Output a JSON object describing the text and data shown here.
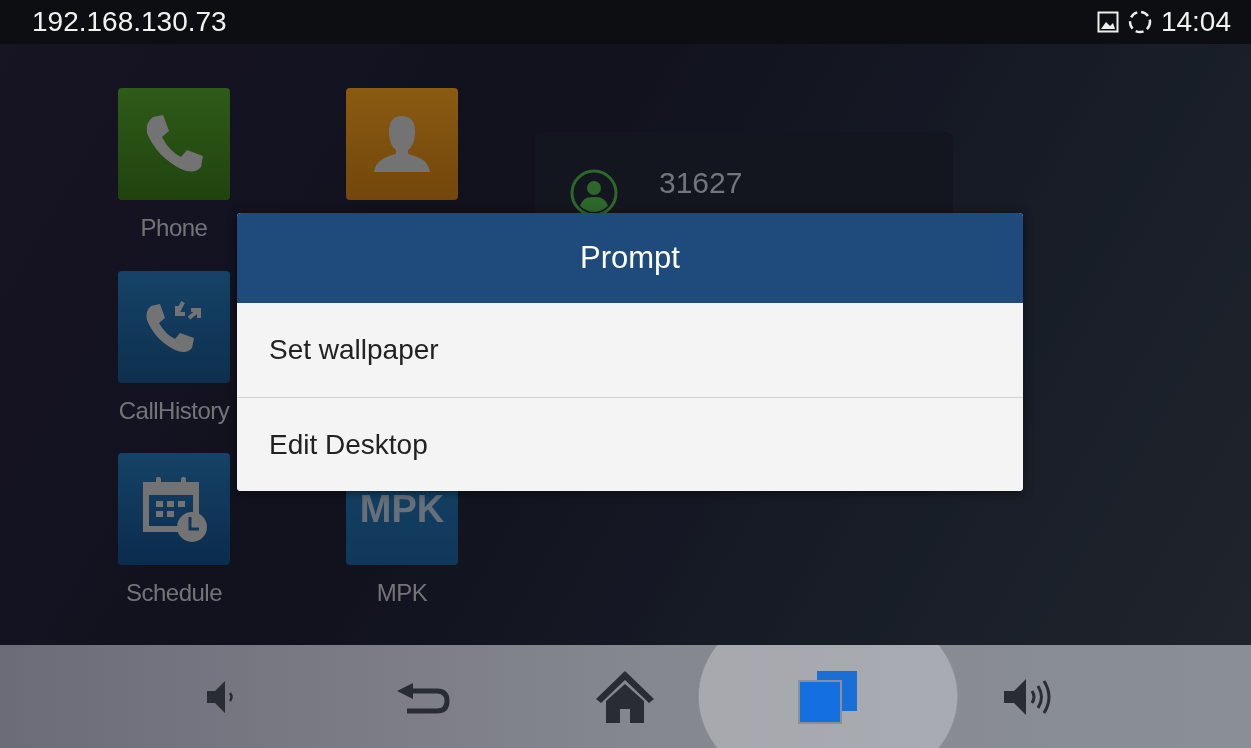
{
  "status_bar": {
    "address": "192.168.130.73",
    "time": "14:04"
  },
  "desktop": {
    "apps": [
      {
        "kind": "phone",
        "label": "Phone"
      },
      {
        "kind": "contacts"
      },
      {
        "kind": "call_history",
        "label": "CallHistory"
      },
      {
        "kind": "schedule",
        "label": "Schedule"
      },
      {
        "kind": "mpk",
        "icon_text": "MPK",
        "label": "MPK"
      }
    ],
    "widget": {
      "number": "31627"
    }
  },
  "dialog": {
    "title": "Prompt",
    "options": [
      "Set wallpaper",
      "Edit Desktop"
    ]
  },
  "nav_bar": [
    {
      "kind": "volume_down",
      "selected": false
    },
    {
      "kind": "back",
      "selected": false
    },
    {
      "kind": "home",
      "selected": false
    },
    {
      "kind": "recent",
      "selected": true
    },
    {
      "kind": "volume_up",
      "selected": false
    }
  ]
}
